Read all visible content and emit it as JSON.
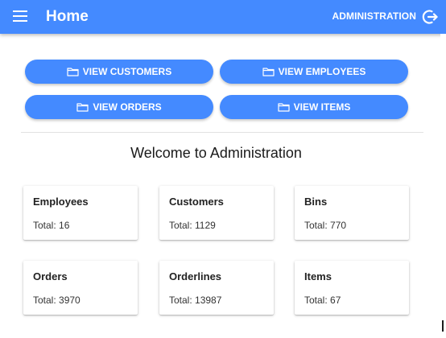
{
  "appbar": {
    "title": "Home",
    "admin_label": "ADMINISTRATION",
    "menu_icon": "menu-icon",
    "logout_icon": "logout-icon",
    "bg_color": "#448aff"
  },
  "nav_buttons": [
    {
      "label": "VIEW CUSTOMERS",
      "icon": "folder-icon"
    },
    {
      "label": "VIEW EMPLOYEES",
      "icon": "folder-icon"
    },
    {
      "label": "VIEW ORDERS",
      "icon": "folder-icon"
    },
    {
      "label": "VIEW ITEMS",
      "icon": "folder-icon"
    }
  ],
  "welcome": "Welcome to Administration",
  "cards": [
    {
      "title": "Employees",
      "total": "Total: 16"
    },
    {
      "title": "Customers",
      "total": "Total: 1129"
    },
    {
      "title": "Bins",
      "total": "Total: 770"
    },
    {
      "title": "Orders",
      "total": "Total: 3970"
    },
    {
      "title": "Orderlines",
      "total": "Total: 13987"
    },
    {
      "title": "Items",
      "total": "Total: 67"
    }
  ]
}
